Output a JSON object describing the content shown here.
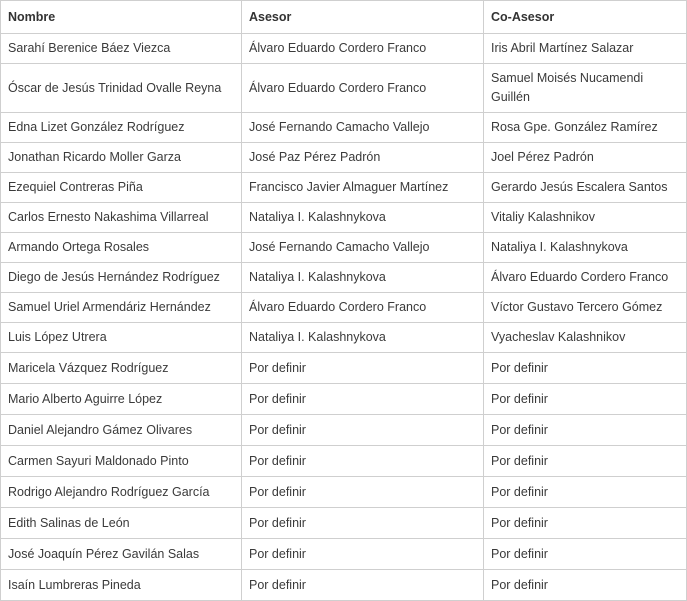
{
  "headers": [
    "Nombre",
    "Asesor",
    "Co-Asesor"
  ],
  "rows": [
    [
      "Sarahí Berenice Báez Viezca",
      "Álvaro Eduardo Cordero Franco",
      "Iris Abril Martínez Salazar"
    ],
    [
      "Óscar de Jesús Trinidad Ovalle Reyna",
      "Álvaro Eduardo Cordero Franco",
      "Samuel Moisés Nucamendi Guillén"
    ],
    [
      "Edna Lizet González Rodríguez",
      "José Fernando Camacho Vallejo",
      "Rosa Gpe. González Ramírez"
    ],
    [
      "Jonathan Ricardo Moller Garza",
      "José Paz Pérez Padrón",
      "Joel Pérez Padrón"
    ],
    [
      "Ezequiel Contreras Piña",
      "Francisco Javier Almaguer Martínez",
      "Gerardo Jesús Escalera Santos"
    ],
    [
      "Carlos Ernesto Nakashima Villarreal",
      "Nataliya I. Kalashnykova",
      "Vitaliy Kalashnikov"
    ],
    [
      "Armando Ortega Rosales",
      "José Fernando Camacho Vallejo",
      "Nataliya I. Kalashnykova"
    ],
    [
      "Diego de Jesús Hernández Rodríguez",
      "Nataliya I. Kalashnykova",
      "Álvaro Eduardo Cordero Franco"
    ],
    [
      "Samuel Uriel Armendáriz Hernández",
      "Álvaro Eduardo Cordero Franco",
      "Víctor Gustavo Tercero Gómez"
    ],
    [
      "Luis López Utrera",
      "Nataliya I. Kalashnykova",
      "Vyacheslav Kalashnikov"
    ],
    [
      "Maricela Vázquez Rodríguez",
      "Por definir",
      "Por definir"
    ],
    [
      "Mario Alberto Aguirre López",
      "Por definir",
      "Por definir"
    ],
    [
      "Daniel Alejandro Gámez Olivares",
      "Por definir",
      "Por definir"
    ],
    [
      "Carmen Sayuri Maldonado Pinto",
      "Por definir",
      "Por definir"
    ],
    [
      "Rodrigo Alejandro Rodríguez García",
      "Por definir",
      "Por definir"
    ],
    [
      "Edith Salinas de León",
      "Por definir",
      "Por definir"
    ],
    [
      "José Joaquín Pérez Gavilán Salas",
      "Por definir",
      "Por definir"
    ],
    [
      "Isaín Lumbreras Pineda",
      "Por definir",
      "Por definir"
    ]
  ]
}
